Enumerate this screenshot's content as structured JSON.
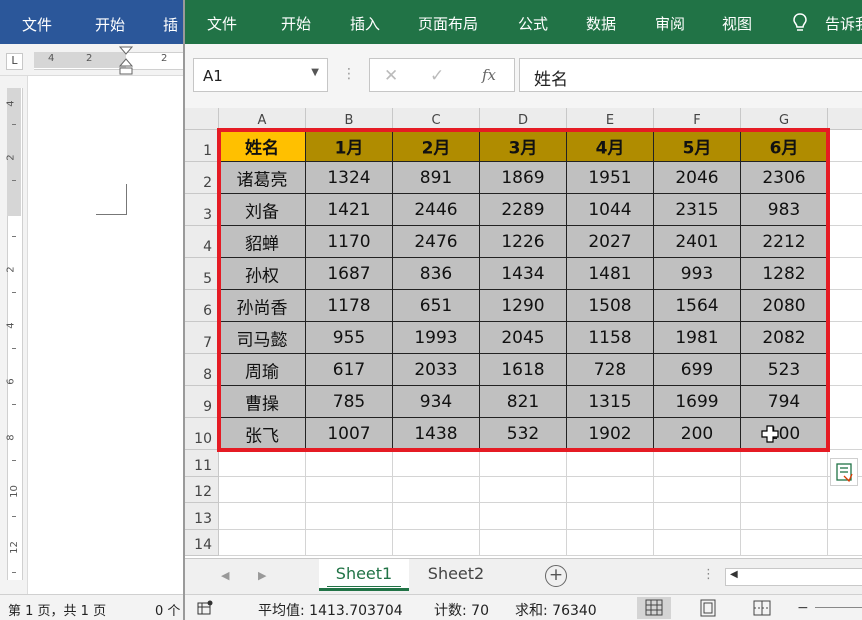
{
  "word": {
    "tabs": [
      "文件",
      "开始",
      "插"
    ],
    "ruler_top": [
      "4",
      "2",
      "2"
    ],
    "ruler_left": [
      "4",
      "2",
      "2",
      "4",
      "6",
      "8",
      "10",
      "12"
    ],
    "status": {
      "page": "第 1 页，共 1 页",
      "words": "0 个"
    }
  },
  "excel": {
    "tabs": [
      "文件",
      "开始",
      "插入",
      "页面布局",
      "公式",
      "数据",
      "审阅",
      "视图",
      "告诉我"
    ],
    "name_box": "A1",
    "formula_value": "姓名",
    "columns": [
      "A",
      "B",
      "C",
      "D",
      "E",
      "F",
      "G"
    ],
    "rows": [
      "1",
      "2",
      "3",
      "4",
      "5",
      "6",
      "7",
      "8",
      "9",
      "10",
      "11",
      "12",
      "13",
      "14"
    ],
    "header_row": [
      "姓名",
      "1月",
      "2月",
      "3月",
      "4月",
      "5月",
      "6月"
    ],
    "data_rows": [
      [
        "诸葛亮",
        "1324",
        "891",
        "1869",
        "1951",
        "2046",
        "2306"
      ],
      [
        "刘备",
        "1421",
        "2446",
        "2289",
        "1044",
        "2315",
        "983"
      ],
      [
        "貂蝉",
        "1170",
        "2476",
        "1226",
        "2027",
        "2401",
        "2212"
      ],
      [
        "孙权",
        "1687",
        "836",
        "1434",
        "1481",
        "993",
        "1282"
      ],
      [
        "孙尚香",
        "1178",
        "651",
        "1290",
        "1508",
        "1564",
        "2080"
      ],
      [
        "司马懿",
        "955",
        "1993",
        "2045",
        "1158",
        "1981",
        "2082"
      ],
      [
        "周瑜",
        "617",
        "2033",
        "1618",
        "728",
        "699",
        "523"
      ],
      [
        "曹操",
        "785",
        "934",
        "821",
        "1315",
        "1699",
        "794"
      ],
      [
        "张飞",
        "1007",
        "1438",
        "532",
        "1902",
        "200",
        "100"
      ]
    ],
    "sheets": [
      "Sheet1",
      "Sheet2"
    ],
    "status": {
      "average": "平均值: 1413.703704",
      "count": "计数: 70",
      "sum": "求和: 76340"
    },
    "colors": {
      "ribbon": "#217346",
      "selection": "#e51b24",
      "header_fill": "#b08c00",
      "name_header_fill": "#ffc000",
      "data_fill": "#c0c0c0"
    }
  }
}
